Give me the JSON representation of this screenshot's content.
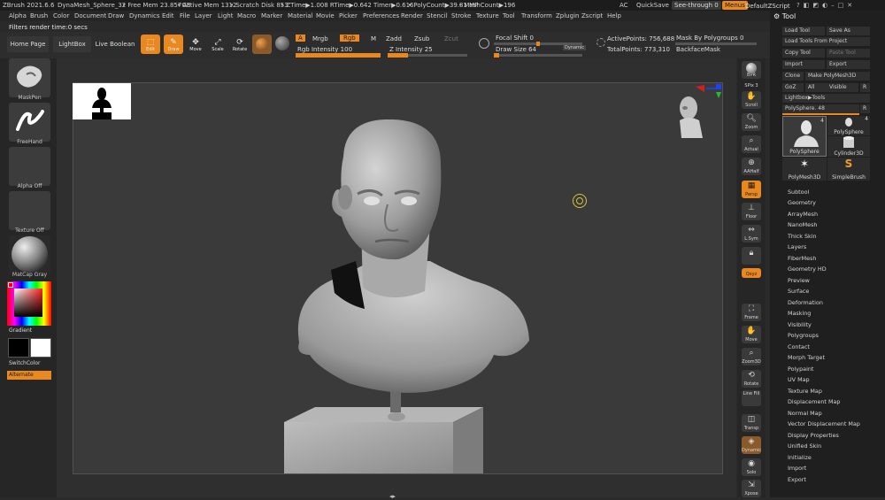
{
  "titlebar": {
    "app": "ZBrush 2021.6.6",
    "doc": "DynaMesh_Sphere_32",
    "free_mem": "• Free Mem 23.857GB",
    "active_mem": "• Active Mem 1312",
    "scratch": "• Scratch Disk 853",
    "ztime": "• ZTime▶1.008 RTime▶0.642 Timer▶0.616",
    "polycount": "• PolyCount▶39.31 MP",
    "meshcount": "• MeshCount▶196",
    "ac": "AC",
    "quicksave": "QuickSave",
    "see_through": "See-through  0",
    "menus": "Menus",
    "script": "DefaultZScript"
  },
  "menubar": [
    "Alpha",
    "Brush",
    "Color",
    "Document",
    "Draw",
    "Dynamics",
    "Edit",
    "File",
    "Layer",
    "Light",
    "Macro",
    "Marker",
    "Material",
    "Movie",
    "Picker",
    "Preferences",
    "Render",
    "Stencil",
    "Stroke",
    "Texture",
    "Tool",
    "Transform",
    "Zplugin",
    "Zscript",
    "Help"
  ],
  "status": "Filters render time:0 secs",
  "topshelf": {
    "home": "Home Page",
    "lightbox": "LightBox",
    "liveboolean": "Live Boolean",
    "edit": "Edit",
    "draw": "Draw",
    "move": "Move",
    "scale": "Scale",
    "rotate": "Rotate",
    "a": "A",
    "mrgb": "Mrgb",
    "rgb": "Rgb",
    "m": "M",
    "zadd": "Zadd",
    "zsub": "Zsub",
    "zcut": "Zcut",
    "rgb_intensity": "Rgb Intensity 100",
    "z_intensity": "Z Intensity 25",
    "focal_shift": "Focal Shift 0",
    "draw_size": "Draw Size 64",
    "dynamic": "Dynamic",
    "active_points": "ActivePoints: 756,688",
    "total_points": "TotalPoints: 773,310",
    "mask_by_polygroups": "Mask By Polygroups 0",
    "backface_mask": "BackfaceMask",
    "rgb_intensity_value": 100,
    "z_intensity_value": 25,
    "focal_shift_value": 0,
    "draw_size_value": 64
  },
  "leftshelf": {
    "brush": "MaskPen",
    "stroke": "FreeHand",
    "alpha": "Alpha Off",
    "texture": "Texture Off",
    "material": "MatCap Gray",
    "gradient": "Gradient",
    "switchcolor": "SwitchColor",
    "alternate": "Alternate"
  },
  "rightshelf": [
    {
      "name": "bpr-icon",
      "label": "BPR"
    },
    {
      "name": "spix-icon",
      "label": "SPix 3"
    },
    {
      "name": "scroll-icon",
      "label": "Scroll"
    },
    {
      "name": "zoom-icon",
      "label": "Zoom"
    },
    {
      "name": "actual-icon",
      "label": "Actual"
    },
    {
      "name": "aahalf-icon",
      "label": "AAHalf"
    },
    {
      "name": "persp-icon",
      "label": "Persp"
    },
    {
      "name": "floor-icon",
      "label": "Floor"
    },
    {
      "name": "lsym-icon",
      "label": "L.Sym"
    },
    {
      "name": "lock-icon",
      "label": ""
    },
    {
      "name": "qxyz-icon",
      "label": "Qxyz"
    },
    {
      "name": "frame-icon",
      "label": "Frame"
    },
    {
      "name": "move-icon",
      "label": "Move"
    },
    {
      "name": "zoom3d-icon",
      "label": "Zoom3D"
    },
    {
      "name": "rotate-icon",
      "label": "Rotate"
    },
    {
      "name": "linefill-icon",
      "label": "Line Fill"
    },
    {
      "name": "transp-icon",
      "label": "Transp"
    },
    {
      "name": "dynamic-icon",
      "label": "Dynamic"
    },
    {
      "name": "solo-icon",
      "label": "Solo"
    },
    {
      "name": "xpose-icon",
      "label": "Xpose"
    }
  ],
  "toolpanel": {
    "title": "Tool",
    "load_tool": "Load Tool",
    "save_as": "Save As",
    "load_from_project": "Load Tools From Project",
    "copy_tool": "Copy Tool",
    "paste_tool": "Paste Tool",
    "import": "Import",
    "export": "Export",
    "clone": "Clone",
    "make_polymesh": "Make PolyMesh3D",
    "goz": "GoZ",
    "all": "All",
    "visible": "Visible",
    "r": "R",
    "lightbox_tools": "Lightbox▶Tools",
    "polysphere_slider": "PolySphere. 48",
    "polysphere_slider_value": 48,
    "thumb_count_1": "4",
    "thumb_count_2": "4",
    "thumbs": [
      "PolySphere",
      "PolySphere",
      "Cylinder3D",
      "PolyMesh3D",
      "SimpleBrush"
    ],
    "subpalettes": [
      "Subtool",
      "Geometry",
      "ArrayMesh",
      "NanoMesh",
      "Thick Skin",
      "Layers",
      "FiberMesh",
      "Geometry HD",
      "Preview",
      "Surface",
      "Deformation",
      "Masking",
      "Visibility",
      "Polygroups",
      "Contact",
      "Morph Target",
      "Polypaint",
      "UV Map",
      "Texture Map",
      "Displacement Map",
      "Normal Map",
      "Vector Displacement Map",
      "Display Properties",
      "Unified Skin",
      "Initialize",
      "Import",
      "Export"
    ]
  },
  "colors": {
    "accent": "#e8881e",
    "bg": "#2a2a2a",
    "panel": "#1f1f1f",
    "viewport": "#3a3a3a"
  }
}
